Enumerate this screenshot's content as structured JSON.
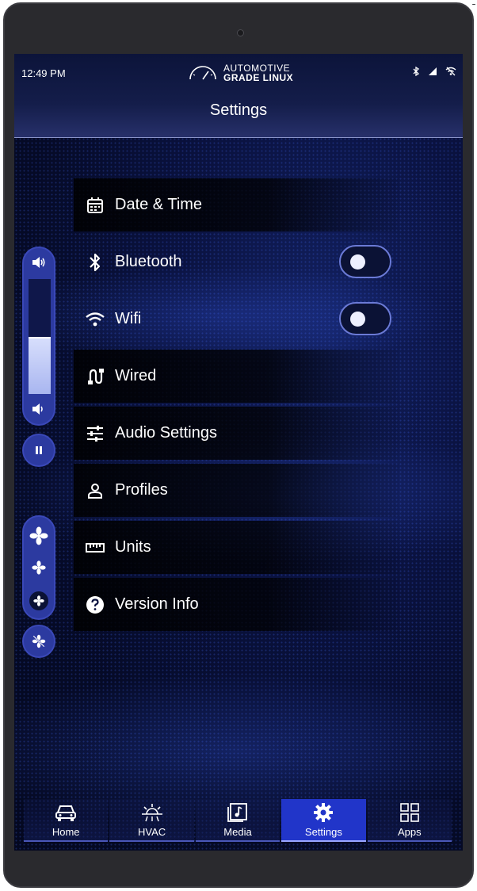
{
  "status_bar": {
    "time": "12:49 PM",
    "logo_line1": "AUTOMOTIVE",
    "logo_line2": "GRADE LINUX",
    "icons": [
      "bluetooth-icon",
      "signal-icon",
      "wifi-off-icon"
    ]
  },
  "header": {
    "title": "Settings"
  },
  "menu": [
    {
      "label": "Date & Time",
      "icon": "calendar-icon"
    },
    {
      "label": "Bluetooth",
      "icon": "bluetooth-icon",
      "toggle": false
    },
    {
      "label": "Wifi",
      "icon": "wifi-icon",
      "toggle": false
    },
    {
      "label": "Wired",
      "icon": "ethernet-icon"
    },
    {
      "label": "Audio Settings",
      "icon": "sliders-icon"
    },
    {
      "label": "Profiles",
      "icon": "person-icon"
    },
    {
      "label": "Units",
      "icon": "ruler-icon"
    },
    {
      "label": "Version Info",
      "icon": "help-icon"
    }
  ],
  "volume": {
    "level": 0.5
  },
  "bottom_nav": [
    {
      "label": "Home",
      "icon": "car-icon",
      "active": false
    },
    {
      "label": "HVAC",
      "icon": "sun-icon",
      "active": false
    },
    {
      "label": "Media",
      "icon": "music-icon",
      "active": false
    },
    {
      "label": "Settings",
      "icon": "gear-icon",
      "active": true
    },
    {
      "label": "Apps",
      "icon": "grid-icon",
      "active": false
    }
  ],
  "colors": {
    "accent": "#2135c9",
    "panel": "#2c3aa0",
    "background": "#050a26"
  }
}
